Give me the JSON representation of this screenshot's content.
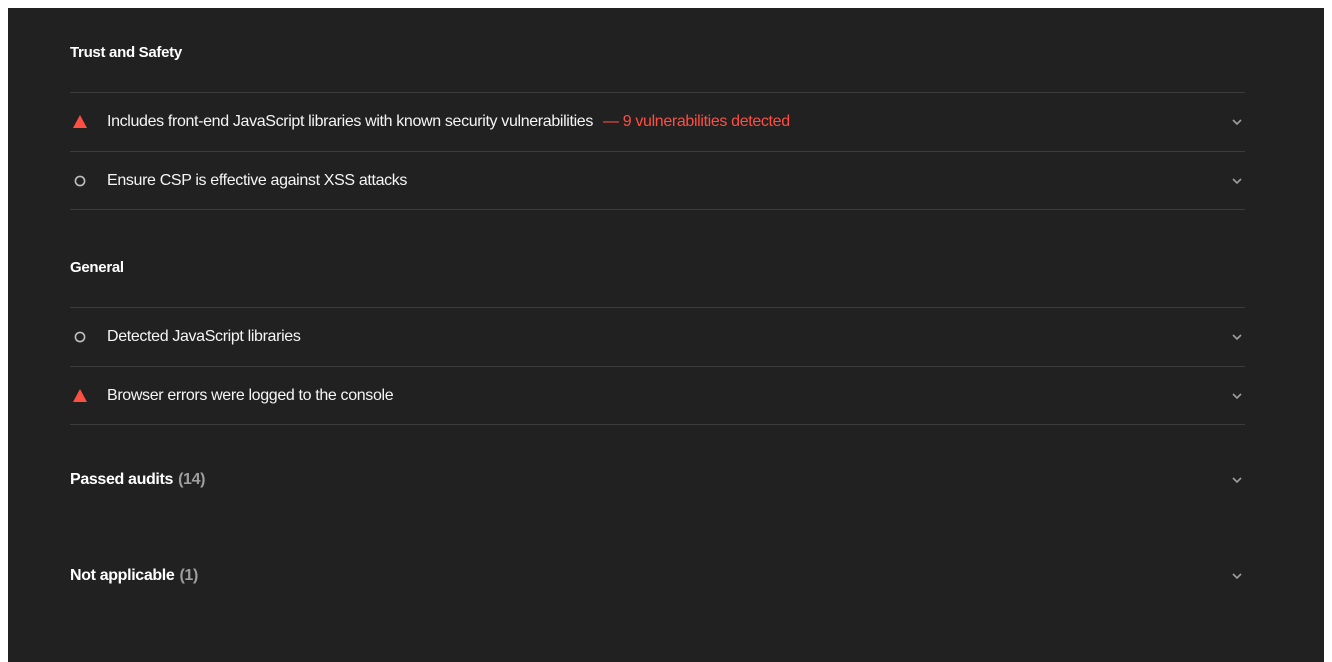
{
  "colors": {
    "background": "#212121",
    "fail": "#ff4e42",
    "text": "#f5f5f5",
    "muted": "#9e9e9e",
    "divider": "#3c3c3c"
  },
  "groups": [
    {
      "title": "Trust and Safety",
      "audits": [
        {
          "status": "fail",
          "icon": "warning-triangle-icon",
          "title": "Includes front-end JavaScript libraries with known security vulnerabilities",
          "display_value": "— 9 vulnerabilities detected"
        },
        {
          "status": "informative",
          "icon": "circle-outline-icon",
          "title": "Ensure CSP is effective against XSS attacks",
          "display_value": ""
        }
      ]
    },
    {
      "title": "General",
      "audits": [
        {
          "status": "informative",
          "icon": "circle-outline-icon",
          "title": "Detected JavaScript libraries",
          "display_value": ""
        },
        {
          "status": "fail",
          "icon": "warning-triangle-icon",
          "title": "Browser errors were logged to the console",
          "display_value": ""
        }
      ]
    }
  ],
  "clumps": [
    {
      "title": "Passed audits",
      "count": "(14)"
    },
    {
      "title": "Not applicable",
      "count": "(1)"
    }
  ]
}
